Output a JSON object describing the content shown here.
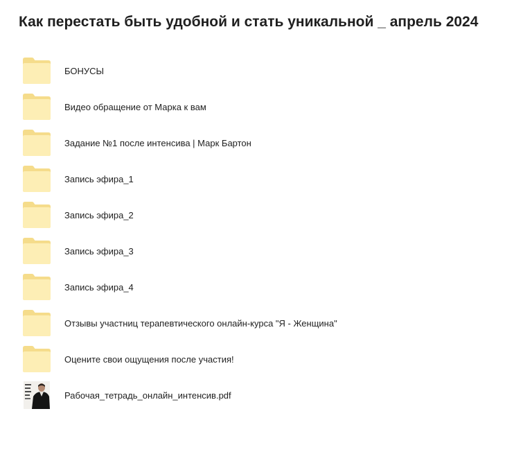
{
  "header": {
    "title": "Как перестать быть удобной и стать уникальной _ апрель 2024"
  },
  "colors": {
    "folder_back": "#f5dc8b",
    "folder_front": "#fdeeb5",
    "text": "#1f1f1f"
  },
  "items": [
    {
      "name": "БОНУСЫ",
      "icon": "folder-icon"
    },
    {
      "name": "Видео обращение от Марка к вам",
      "icon": "folder-icon"
    },
    {
      "name": "Задание №1 после интенсива | Марк Бартон",
      "icon": "folder-icon"
    },
    {
      "name": "Запись эфира_1",
      "icon": "folder-icon"
    },
    {
      "name": "Запись эфира_2",
      "icon": "folder-icon"
    },
    {
      "name": "Запись эфира_3",
      "icon": "folder-icon"
    },
    {
      "name": "Запись эфира_4",
      "icon": "folder-icon"
    },
    {
      "name": "Отзывы участниц терапевтического онлайн-курса \"Я - Женщина\"",
      "icon": "folder-icon"
    },
    {
      "name": "Оцените свои ощущения после участия!",
      "icon": "folder-icon"
    },
    {
      "name": "Рабочая_тетрадь_онлайн_интенсив.pdf",
      "icon": "pdf-thumbnail"
    }
  ]
}
